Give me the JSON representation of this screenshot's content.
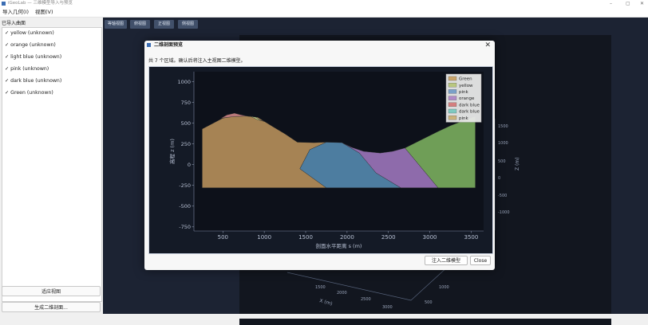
{
  "window": {
    "title": "iGeoLab — 三维模型导入与预览",
    "controls": [
      "–",
      "▢",
      "✕"
    ]
  },
  "menu": [
    {
      "label": "导入几何(I)"
    },
    {
      "label": "视图(V)"
    }
  ],
  "left_panel": {
    "header": "已导入曲面",
    "items": [
      {
        "check": "✓",
        "label": "yellow  (unknown)"
      },
      {
        "check": "✓",
        "label": "orange  (unknown)"
      },
      {
        "check": "✓",
        "label": "light blue  (unknown)"
      },
      {
        "check": "✓",
        "label": "pink  (unknown)"
      },
      {
        "check": "✓",
        "label": "dark blue  (unknown)"
      },
      {
        "check": "✓",
        "label": "Green  (unknown)"
      }
    ],
    "fit_view_btn": "适应视图",
    "gen_section_btn": "生成二维剖面..."
  },
  "toolbar": [
    "等轴视图",
    "俯视图",
    "正视图",
    "侧视图"
  ],
  "scene3d": {
    "xlabel": "X (m)",
    "x_ticks": [
      "1500",
      "2000",
      "2500",
      "3000"
    ],
    "y_ticks": [
      "500",
      "1000"
    ],
    "z_label": "Z (m)",
    "z_ticks": [
      "1500",
      "1000",
      "500",
      "0",
      "-500",
      "-1000"
    ]
  },
  "dialog": {
    "title": "二维剖面预览",
    "close": "✕",
    "info": "共 7 个区域。确认后将注入主视图二维模型。",
    "inject_btn": "注入二维模型",
    "close_btn": "Close"
  },
  "chart_data": {
    "type": "area",
    "xlabel": "剖面水平距离 s (m)",
    "ylabel": "高程 z (m)",
    "xlim": [
      150,
      3650
    ],
    "ylim": [
      -800,
      1120
    ],
    "x_ticks": [
      500,
      1000,
      1500,
      2000,
      2500,
      3000,
      3500
    ],
    "y_ticks": [
      1000,
      750,
      500,
      250,
      0,
      -250,
      -500,
      -750
    ],
    "legend_position": "top-right",
    "legend": [
      {
        "name": "Green",
        "color": "#c9a46a"
      },
      {
        "name": "yellow",
        "color": "#b9c77f"
      },
      {
        "name": "pink",
        "color": "#7aa0c8"
      },
      {
        "name": "orange",
        "color": "#b08ac7"
      },
      {
        "name": "dark blue",
        "color": "#d47f7f"
      },
      {
        "name": "dark blue",
        "color": "#7fc9c0"
      },
      {
        "name": "pink",
        "color": "#c9b27a"
      }
    ],
    "regions": [
      {
        "color": "#a68354",
        "points": [
          [
            250,
            430
          ],
          [
            500,
            560
          ],
          [
            620,
            580
          ],
          [
            780,
            585
          ],
          [
            920,
            570
          ],
          [
            1100,
            460
          ],
          [
            1250,
            370
          ],
          [
            1400,
            270
          ],
          [
            1600,
            265
          ],
          [
            1750,
            270
          ],
          [
            1550,
            180
          ],
          [
            1430,
            -50
          ],
          [
            1750,
            -280
          ],
          [
            250,
            -280
          ]
        ]
      },
      {
        "color": "#b8d08a",
        "points": [
          [
            820,
            585
          ],
          [
            900,
            570
          ],
          [
            950,
            535
          ],
          [
            1000,
            520
          ],
          [
            920,
            540
          ],
          [
            860,
            570
          ]
        ]
      },
      {
        "color": "#b8787a",
        "points": [
          [
            480,
            560
          ],
          [
            550,
            600
          ],
          [
            640,
            620
          ],
          [
            720,
            600
          ],
          [
            800,
            585
          ],
          [
            640,
            580
          ]
        ]
      },
      {
        "color": "#4d7da0",
        "points": [
          [
            1430,
            -50
          ],
          [
            1550,
            180
          ],
          [
            1750,
            270
          ],
          [
            1940,
            265
          ],
          [
            2150,
            140
          ],
          [
            2350,
            -100
          ],
          [
            2650,
            -280
          ],
          [
            1750,
            -280
          ]
        ]
      },
      {
        "color": "#8e6bab",
        "points": [
          [
            1940,
            265
          ],
          [
            2050,
            210
          ],
          [
            2200,
            160
          ],
          [
            2400,
            140
          ],
          [
            2550,
            160
          ],
          [
            2700,
            200
          ],
          [
            3100,
            -280
          ],
          [
            2650,
            -280
          ],
          [
            2350,
            -100
          ],
          [
            2150,
            140
          ]
        ]
      },
      {
        "color": "#6f9e57",
        "points": [
          [
            2700,
            200
          ],
          [
            2900,
            300
          ],
          [
            3100,
            400
          ],
          [
            3250,
            470
          ],
          [
            3380,
            520
          ],
          [
            3550,
            580
          ],
          [
            3550,
            -280
          ],
          [
            3100,
            -280
          ]
        ]
      }
    ]
  }
}
